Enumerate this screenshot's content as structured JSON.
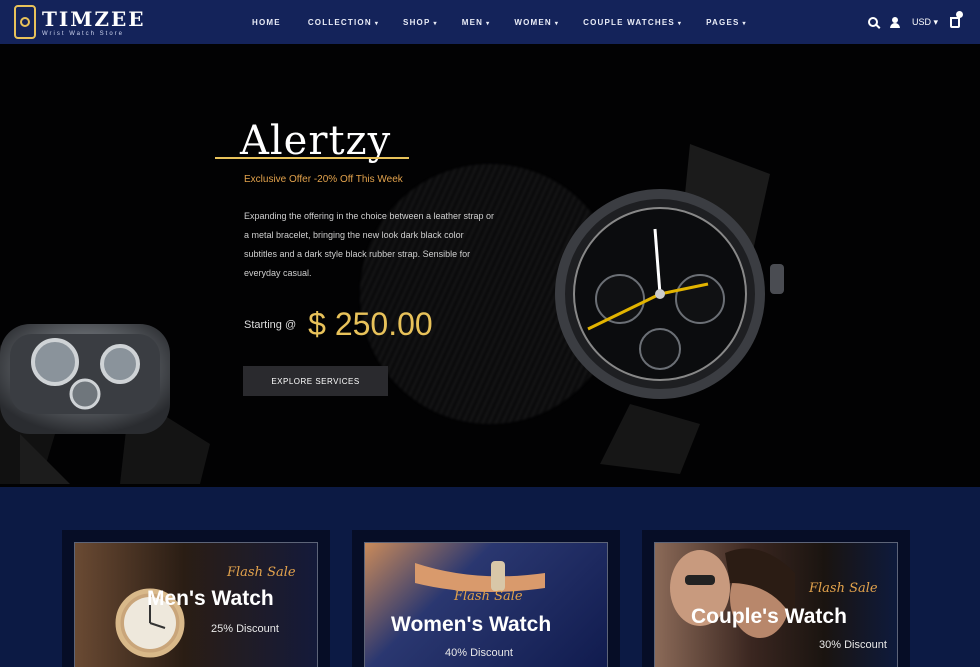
{
  "brand": {
    "name": "TIMZEE",
    "tagline": "Wrist Watch Store"
  },
  "nav": {
    "items": [
      {
        "label": "HOME",
        "caret": ""
      },
      {
        "label": "COLLECTION",
        "caret": "▾"
      },
      {
        "label": "SHOP",
        "caret": "▾"
      },
      {
        "label": "MEN",
        "caret": "▾"
      },
      {
        "label": "WOMEN",
        "caret": "▾"
      },
      {
        "label": "COUPLE WATCHES",
        "caret": "▾"
      },
      {
        "label": "PAGES",
        "caret": "▾"
      }
    ],
    "currency": "USD ▾",
    "icons": [
      "search-icon",
      "user-icon",
      "cart-icon"
    ]
  },
  "hero": {
    "title": "Alertzy",
    "subtitle": "Exclusive Offer -20% Off This Week",
    "description": "Expanding the offering in the choice between a leather strap or a metal bracelet, bringing the new look dark black color subtitles and a dark style black rubber strap. Sensible for everyday casual.",
    "starting_label": "Starting @",
    "price": "$ 250.00",
    "cta_label": "EXPLORE SERVICES"
  },
  "categories": [
    {
      "tag": "Flash Sale",
      "title": "Men's Watch",
      "discount": "25% Discount"
    },
    {
      "tag": "Flash Sale",
      "title": "Women's Watch",
      "discount": "40% Discount"
    },
    {
      "tag": "Flash Sale",
      "title": "Couple's Watch",
      "discount": "30% Discount"
    }
  ],
  "colors": {
    "nav_bg": "#14235a",
    "accent_gold": "#e8c25a",
    "accent_orange": "#e2a24c",
    "hero_bg": "#020203",
    "strip_bg": "#0c1a44"
  }
}
